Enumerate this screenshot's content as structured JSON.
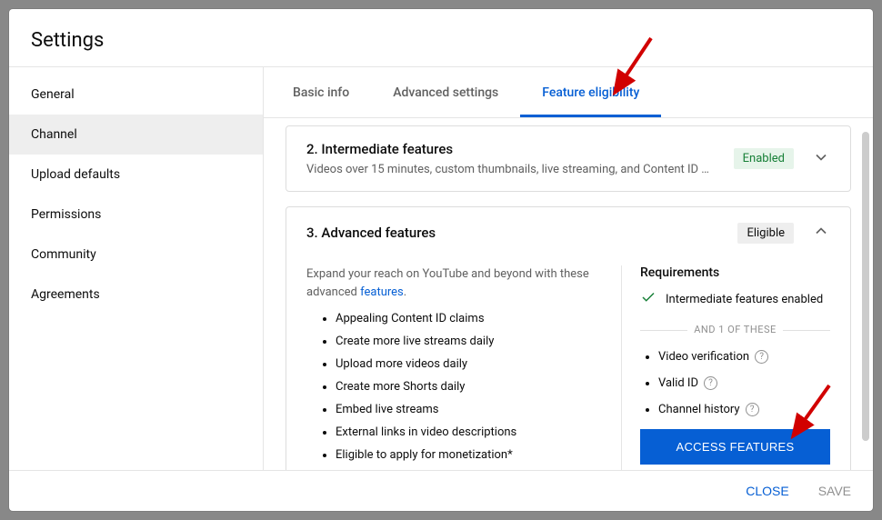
{
  "title": "Settings",
  "sidebar": {
    "items": [
      {
        "label": "General"
      },
      {
        "label": "Channel"
      },
      {
        "label": "Upload defaults"
      },
      {
        "label": "Permissions"
      },
      {
        "label": "Community"
      },
      {
        "label": "Agreements"
      }
    ]
  },
  "tabs": [
    {
      "label": "Basic info"
    },
    {
      "label": "Advanced settings"
    },
    {
      "label": "Feature eligibility"
    }
  ],
  "intermediate": {
    "title": "2. Intermediate features",
    "desc": "Videos over 15 minutes, custom thumbnails, live streaming, and Content ID …",
    "badge": "Enabled"
  },
  "advanced": {
    "title": "3. Advanced features",
    "badge": "Eligible",
    "lead_a": "Expand your reach on YouTube and beyond with these advanced ",
    "lead_link": "features",
    "lead_b": ".",
    "bullets": [
      "Appealing Content ID claims",
      "Create more live streams daily",
      "Upload more videos daily",
      "Create more Shorts daily",
      "Embed live streams",
      "External links in video descriptions",
      "Eligible to apply for monetization*"
    ],
    "req_title": "Requirements",
    "req_met": "Intermediate features enabled",
    "divider": "AND 1 OF THESE",
    "req_options": [
      "Video verification",
      "Valid ID",
      "Channel history"
    ],
    "access_btn": "ACCESS FEATURES"
  },
  "footer": {
    "close": "CLOSE",
    "save": "SAVE"
  }
}
